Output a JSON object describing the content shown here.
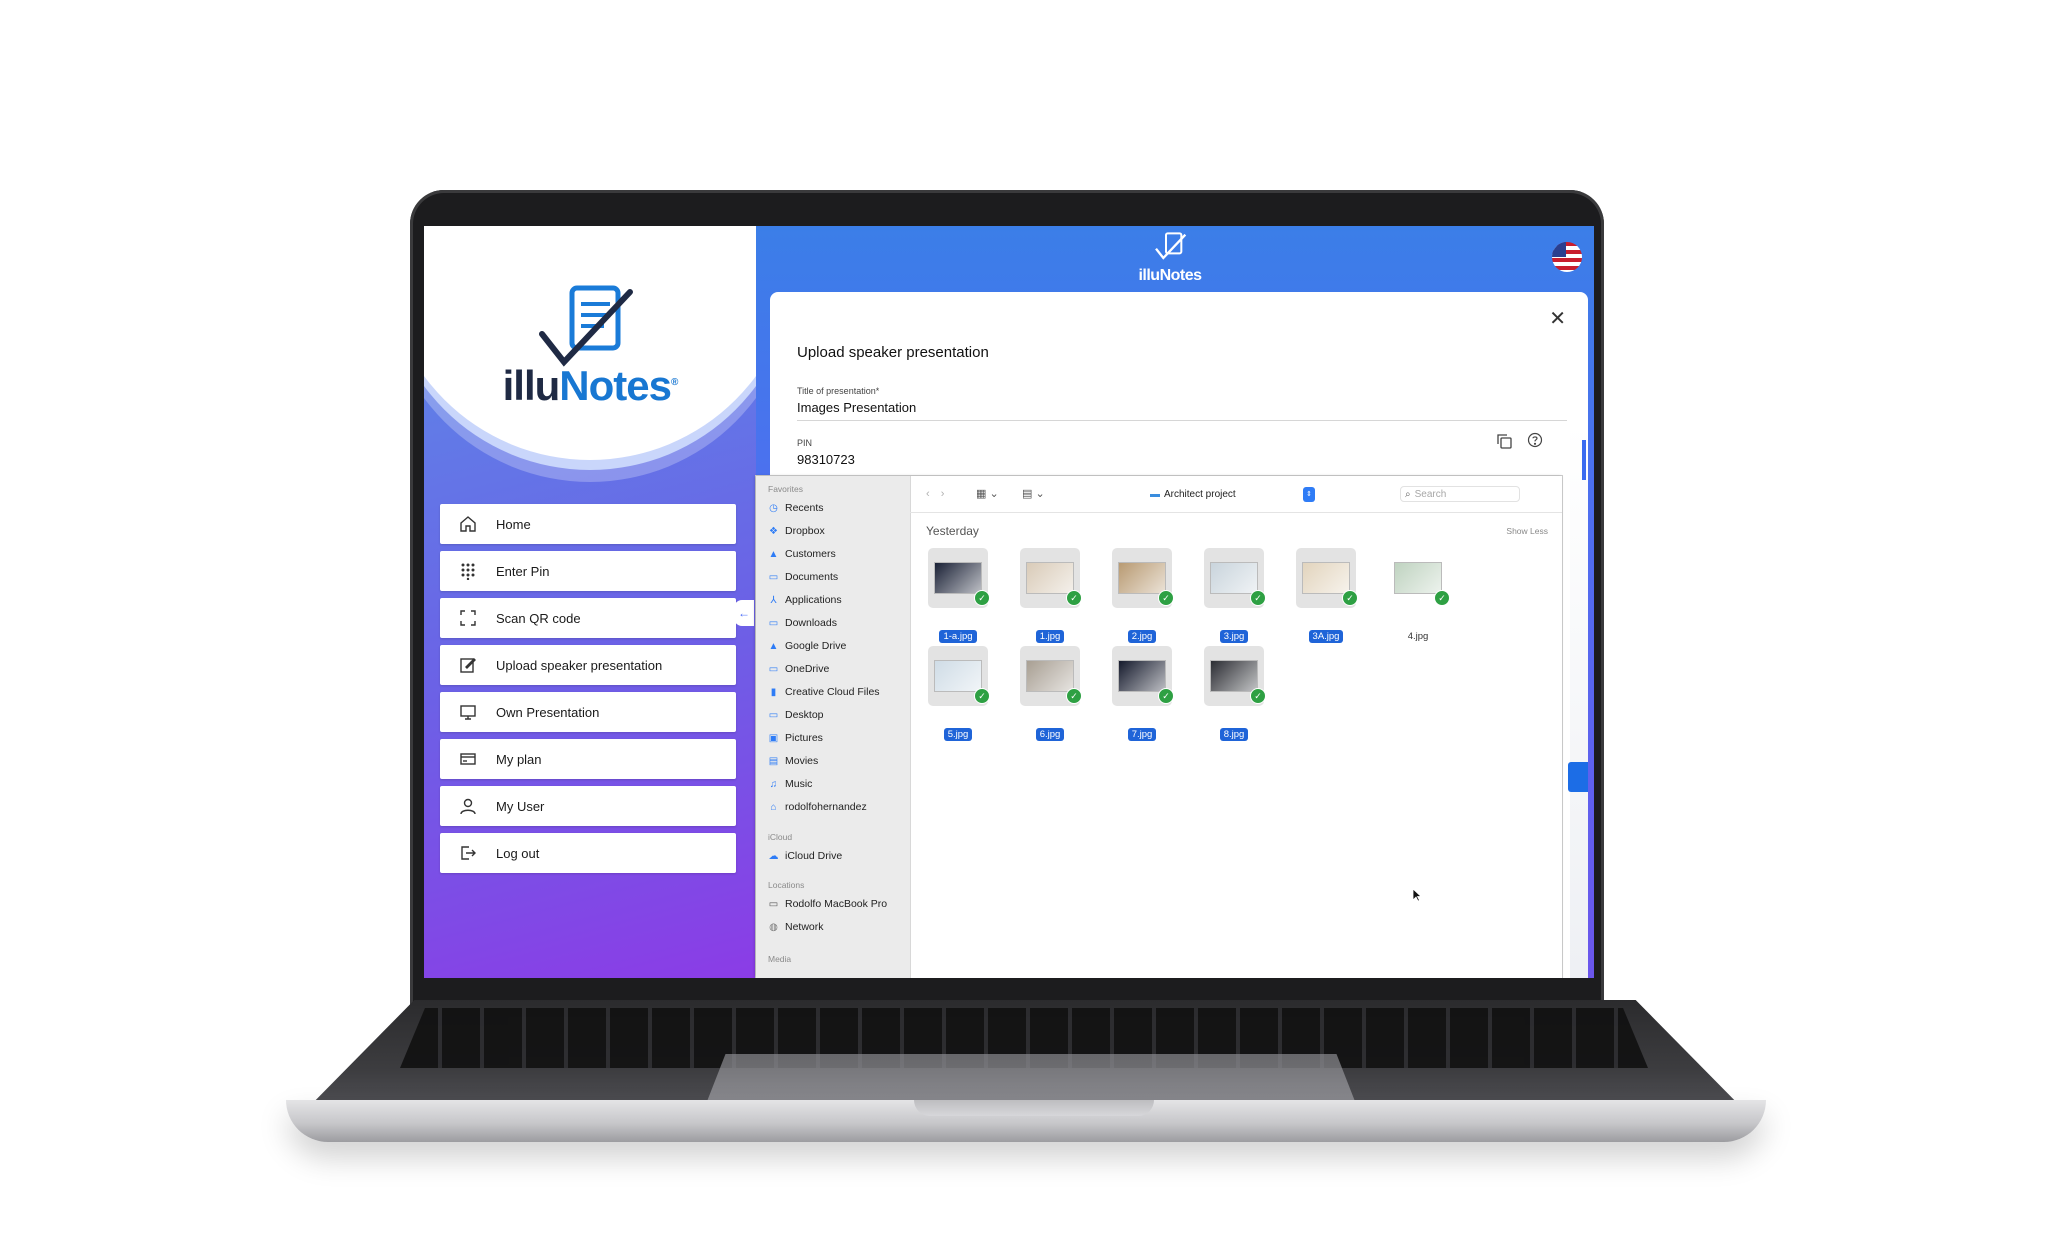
{
  "app": {
    "brand_left": "illu",
    "brand_right": "Notes",
    "trademark": "®"
  },
  "sidebar": {
    "items": [
      {
        "label": "Home",
        "icon": "home-icon"
      },
      {
        "label": "Enter Pin",
        "icon": "keypad-icon"
      },
      {
        "label": "Scan QR code",
        "icon": "scan-icon"
      },
      {
        "label": "Upload speaker presentation",
        "icon": "edit-icon"
      },
      {
        "label": "Own Presentation",
        "icon": "presentation-icon"
      },
      {
        "label": "My plan",
        "icon": "credit-card-icon"
      },
      {
        "label": "My User",
        "icon": "user-icon"
      },
      {
        "label": "Log out",
        "icon": "logout-icon"
      }
    ],
    "collapse_glyph": "←"
  },
  "header": {
    "brand": "illuNotes",
    "language_icon": "us-flag-icon"
  },
  "dialog": {
    "close_glyph": "✕",
    "title": "Upload speaker presentation",
    "title_field": {
      "label": "Title of presentation",
      "required_mark": "*",
      "value": "Images Presentation"
    },
    "pin_field": {
      "label": "PIN",
      "value": "98310723"
    }
  },
  "picker": {
    "sections": {
      "favorites": "Favorites",
      "icloud": "iCloud",
      "locations": "Locations",
      "media": "Media"
    },
    "favorites": [
      {
        "label": "Recents",
        "icon": "clock-icon"
      },
      {
        "label": "Dropbox",
        "icon": "dropbox-icon"
      },
      {
        "label": "Customers",
        "icon": "google-drive-icon"
      },
      {
        "label": "Documents",
        "icon": "folder-icon"
      },
      {
        "label": "Applications",
        "icon": "applications-icon"
      },
      {
        "label": "Downloads",
        "icon": "folder-icon"
      },
      {
        "label": "Google Drive",
        "icon": "google-drive-icon"
      },
      {
        "label": "OneDrive",
        "icon": "folder-icon"
      },
      {
        "label": "Creative Cloud Files",
        "icon": "file-icon"
      },
      {
        "label": "Desktop",
        "icon": "folder-icon"
      },
      {
        "label": "Pictures",
        "icon": "pictures-icon"
      },
      {
        "label": "Movies",
        "icon": "movies-icon"
      },
      {
        "label": "Music",
        "icon": "music-icon"
      },
      {
        "label": "rodolfohernandez",
        "icon": "home-icon"
      }
    ],
    "icloud_items": [
      {
        "label": "iCloud Drive",
        "icon": "cloud-icon"
      }
    ],
    "locations_items": [
      {
        "label": "Rodolfo MacBook Pro",
        "icon": "laptop-icon"
      },
      {
        "label": "Network",
        "icon": "network-icon"
      }
    ],
    "toolbar": {
      "back_forward": "‹ ›",
      "icon_view": "▦ ⌄",
      "group_view": "▤ ⌄",
      "location": "Architect project",
      "search_placeholder": "Search"
    },
    "group_title": "Yesterday",
    "show_less": "Show Less",
    "files": [
      {
        "name": "1-a.jpg",
        "selected": true,
        "tone": "#1a2136"
      },
      {
        "name": "1.jpg",
        "selected": true,
        "tone": "#d9cbb8"
      },
      {
        "name": "2.jpg",
        "selected": true,
        "tone": "#b89a72"
      },
      {
        "name": "3.jpg",
        "selected": true,
        "tone": "#c9d4dc"
      },
      {
        "name": "3A.jpg",
        "selected": true,
        "tone": "#e2d4bd"
      },
      {
        "name": "4.jpg",
        "selected": false,
        "tone": "#bfd3c0"
      },
      {
        "name": "5.jpg",
        "selected": true,
        "tone": "#cfdce6"
      },
      {
        "name": "6.jpg",
        "selected": true,
        "tone": "#a89f93"
      },
      {
        "name": "7.jpg",
        "selected": true,
        "tone": "#151a2c"
      },
      {
        "name": "8.jpg",
        "selected": true,
        "tone": "#2b2d33"
      }
    ]
  },
  "colors": {
    "accent": "#1f64d8",
    "check": "#2ea043",
    "sidebar_gradient_start": "#5a8de8",
    "sidebar_gradient_end": "#8b3ce6"
  }
}
